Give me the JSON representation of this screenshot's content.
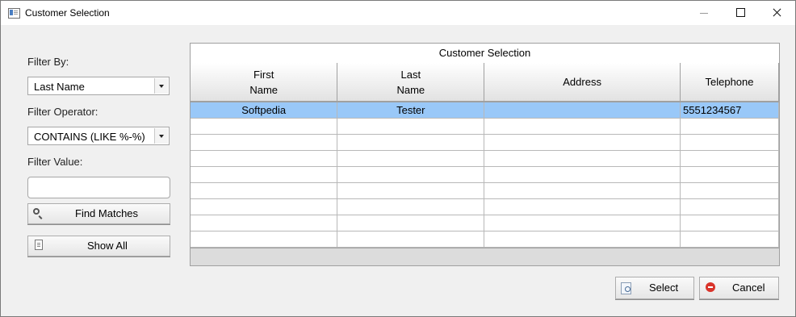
{
  "window": {
    "title": "Customer Selection"
  },
  "filters": {
    "filter_by_label": "Filter By:",
    "filter_by_value": "Last Name",
    "filter_operator_label": "Filter Operator:",
    "filter_operator_value": "CONTAINS (LIKE %-%)",
    "filter_value_label": "Filter Value:",
    "filter_value_input": "",
    "find_matches_label": "Find Matches",
    "show_all_label": "Show All"
  },
  "grid": {
    "title": "Customer Selection",
    "columns": {
      "first_name_l1": "First",
      "first_name_l2": "Name",
      "last_name_l1": "Last",
      "last_name_l2": "Name",
      "address": "Address",
      "telephone": "Telephone"
    },
    "rows": [
      {
        "first_name": "Softpedia",
        "last_name": "Tester",
        "address": "",
        "telephone": "5551234567"
      }
    ]
  },
  "actions": {
    "select_label": "Select",
    "cancel_label": "Cancel"
  },
  "colors": {
    "selected_row": "#99c8f8",
    "cancel_icon": "#d9342b"
  }
}
